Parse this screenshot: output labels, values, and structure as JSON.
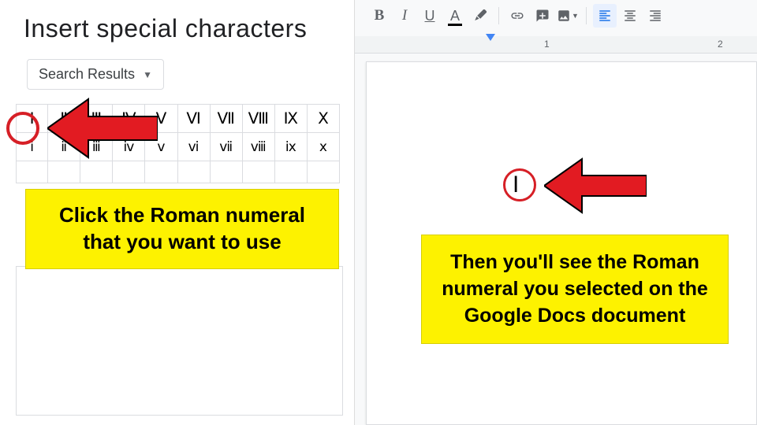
{
  "left": {
    "title": "Insert special characters",
    "dropdown_label": "Search Results",
    "grid_upper": [
      "Ⅰ",
      "Ⅱ",
      "Ⅲ",
      "Ⅳ",
      "Ⅴ",
      "Ⅵ",
      "Ⅶ",
      "Ⅷ",
      "Ⅸ",
      "Ⅹ"
    ],
    "grid_lower": [
      "ⅰ",
      "ⅱ",
      "ⅲ",
      "ⅳ",
      "ⅴ",
      "ⅵ",
      "ⅶ",
      "ⅷ",
      "ⅸ",
      "ⅹ"
    ],
    "callout": "Click the Roman numeral that you want to use"
  },
  "right": {
    "toolbar": {
      "bold": "B",
      "italic": "I",
      "underline": "U",
      "text_color": "A"
    },
    "ruler": {
      "marks": [
        "1",
        "2"
      ]
    },
    "inserted_char": "Ⅰ",
    "callout": "Then you'll see the Roman numeral you selected on the Google Docs document"
  }
}
